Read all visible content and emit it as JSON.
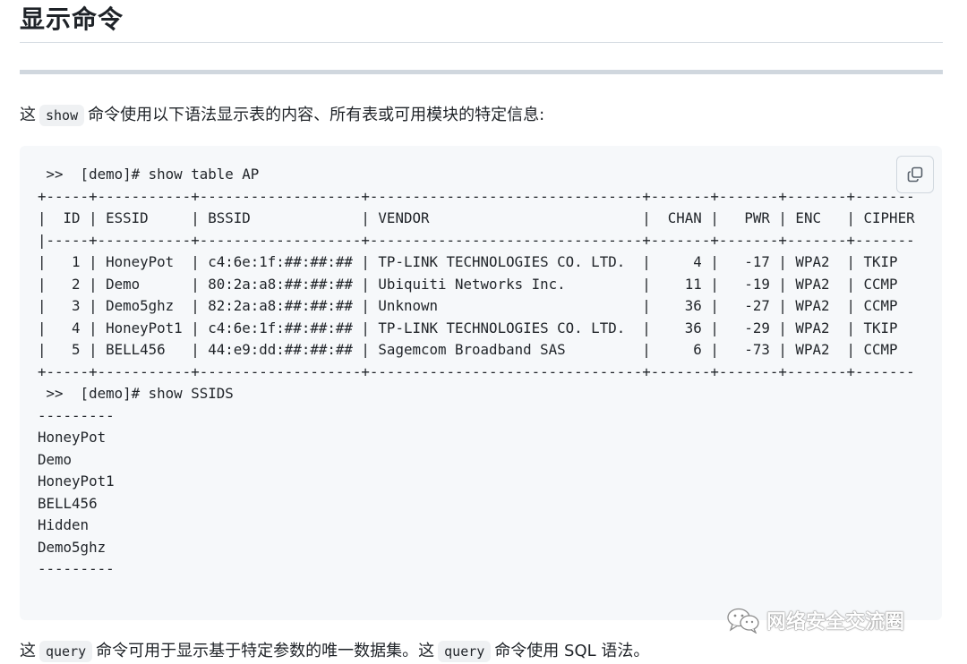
{
  "heading": "显示命令",
  "para1": {
    "before": "这",
    "code": "show",
    "after": "命令使用以下语法显示表的内容、所有表或可用模块的特定信息:"
  },
  "code_block": {
    "lines": [
      " >>  [demo]# show table AP",
      "+-----+-----------+-------------------+--------------------------------+-------+-------+-------+-------",
      "|  ID | ESSID     | BSSID             | VENDOR                         |  CHAN |   PWR | ENC   | CIPHER",
      "|-----+-----------+-------------------+--------------------------------+-------+-------+-------+-------",
      "|   1 | HoneyPot  | c4:6e:1f:##:##:## | TP-LINK TECHNOLOGIES CO. LTD.  |     4 |   -17 | WPA2  | TKIP",
      "|   2 | Demo      | 80:2a:a8:##:##:## | Ubiquiti Networks Inc.         |    11 |   -19 | WPA2  | CCMP",
      "|   3 | Demo5ghz  | 82:2a:a8:##:##:## | Unknown                        |    36 |   -27 | WPA2  | CCMP",
      "|   4 | HoneyPot1 | c4:6e:1f:##:##:## | TP-LINK TECHNOLOGIES CO. LTD.  |    36 |   -29 | WPA2  | TKIP",
      "|   5 | BELL456   | 44:e9:dd:##:##:## | Sagemcom Broadband SAS         |     6 |   -73 | WPA2  | CCMP",
      "+-----+-----------+-------------------+--------------------------------+-------+-------+-------+-------",
      " >>  [demo]# show SSIDS",
      "---------",
      "HoneyPot",
      "Demo",
      "HoneyPot1",
      "BELL456",
      "Hidden",
      "Demo5ghz",
      "---------"
    ]
  },
  "copy_icon": "copy-icon",
  "watermark": {
    "icon": "wechat-icon",
    "text": "网络安全交流圈"
  },
  "para2": {
    "t1": "这",
    "code1": "query",
    "t2": "命令可用于显示基于特定参数的唯一数据集。这",
    "code2": "query",
    "t3": "命令使用 SQL 语法。"
  }
}
